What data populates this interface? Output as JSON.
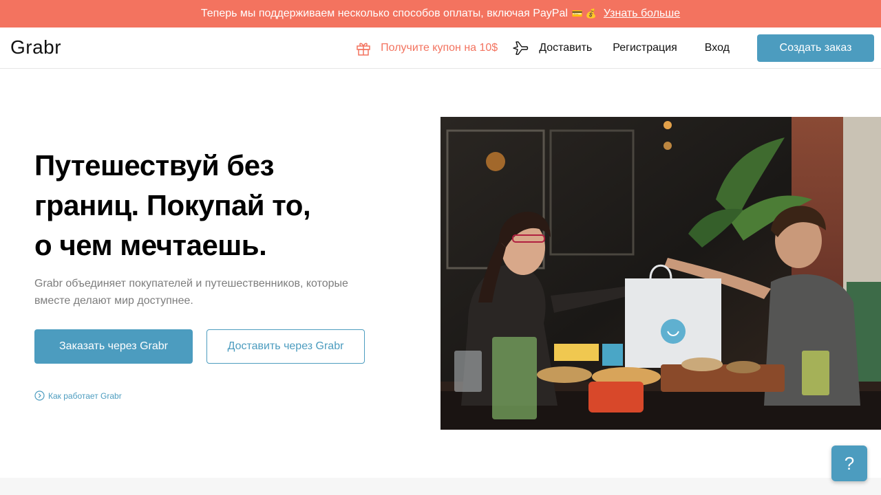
{
  "promo": {
    "text": "Теперь мы поддерживаем несколько способов оплаты, включая PayPal",
    "emoji": "💳 💰",
    "link": "Узнать больше"
  },
  "header": {
    "logo": "Grabr",
    "coupon": "Получите купон на 10$",
    "deliver": "Доставить",
    "register": "Регистрация",
    "login": "Вход",
    "create_order": "Создать заказ"
  },
  "hero": {
    "title_line1": "Путешествуй без",
    "title_line2": "границ. Покупай то,",
    "title_line3": "о чем мечтаешь.",
    "subtitle_line1": "Grabr объединяет покупателей и путешественников, которые",
    "subtitle_line2": "вместе делают мир доступнее.",
    "order_button": "Заказать через Grabr",
    "deliver_button": "Доставить через Grabr",
    "how_it_works": "Как работает Grabr"
  },
  "help": {
    "label": "?"
  },
  "colors": {
    "promo_bg": "#f3735f",
    "accent": "#4c9cbf",
    "coupon": "#f3735f"
  }
}
